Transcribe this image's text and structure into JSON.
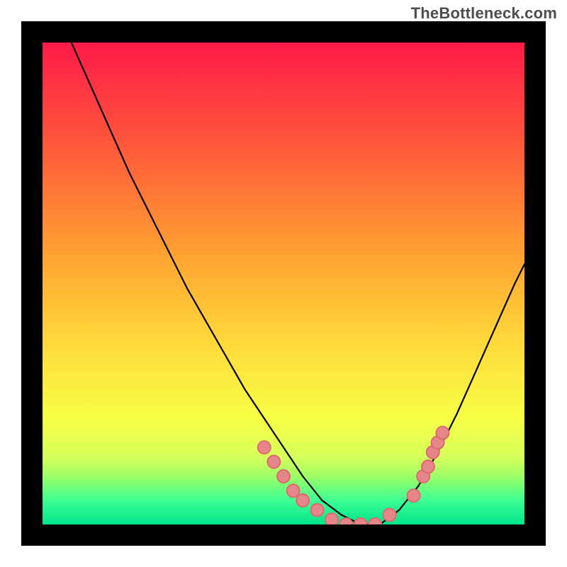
{
  "watermark": "TheBottleneck.com",
  "chart_data": {
    "type": "line",
    "title": "",
    "xlabel": "",
    "ylabel": "",
    "xlim": [
      0,
      100
    ],
    "ylim": [
      0,
      100
    ],
    "grid": false,
    "legend": false,
    "gradient_stops": [
      {
        "offset": 0.0,
        "color": "#ff1a49"
      },
      {
        "offset": 0.22,
        "color": "#ff5a3a"
      },
      {
        "offset": 0.45,
        "color": "#ffa531"
      },
      {
        "offset": 0.62,
        "color": "#ffd83a"
      },
      {
        "offset": 0.78,
        "color": "#f7ff45"
      },
      {
        "offset": 0.86,
        "color": "#d7ff5a"
      },
      {
        "offset": 0.9,
        "color": "#9dff66"
      },
      {
        "offset": 0.95,
        "color": "#3dff94"
      },
      {
        "offset": 1.0,
        "color": "#00e38a"
      }
    ],
    "series": [
      {
        "name": "curve",
        "stroke": "#000000",
        "x": [
          6,
          10,
          14,
          18,
          22,
          26,
          30,
          34,
          38,
          42,
          46,
          50,
          54,
          58,
          62,
          66,
          70,
          74,
          78,
          82,
          86,
          90,
          94,
          98,
          100
        ],
        "y": [
          100,
          91,
          82,
          73,
          65,
          57,
          49,
          42,
          35,
          28,
          22,
          16,
          10,
          5,
          2,
          0,
          0,
          3,
          8,
          15,
          23,
          32,
          41,
          50,
          54
        ]
      }
    ],
    "markers": {
      "stroke": "#dd6a6e",
      "fill": "#e6868a",
      "radius": 9,
      "points": [
        {
          "x": 46,
          "y": 16
        },
        {
          "x": 48,
          "y": 13
        },
        {
          "x": 50,
          "y": 10
        },
        {
          "x": 52,
          "y": 7
        },
        {
          "x": 54,
          "y": 5
        },
        {
          "x": 57,
          "y": 3
        },
        {
          "x": 60,
          "y": 1
        },
        {
          "x": 63,
          "y": 0
        },
        {
          "x": 66,
          "y": 0
        },
        {
          "x": 69,
          "y": 0
        },
        {
          "x": 72,
          "y": 2
        },
        {
          "x": 77,
          "y": 6
        },
        {
          "x": 79,
          "y": 10
        },
        {
          "x": 80,
          "y": 12
        },
        {
          "x": 81,
          "y": 15
        },
        {
          "x": 82,
          "y": 17
        },
        {
          "x": 83,
          "y": 19
        }
      ]
    }
  }
}
